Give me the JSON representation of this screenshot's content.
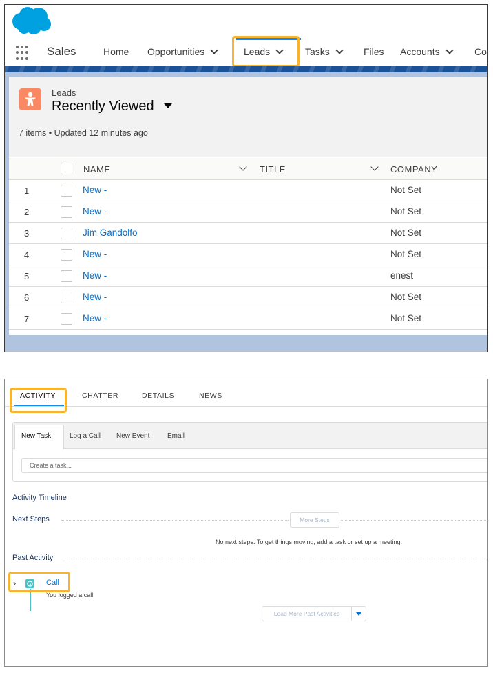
{
  "top_nav": {
    "app_name": "Sales",
    "items": [
      "Home",
      "Opportunities",
      "Leads",
      "Tasks",
      "Files",
      "Accounts",
      "Co"
    ]
  },
  "list_view": {
    "object_label": "Leads",
    "view_name": "Recently Viewed",
    "meta": "7 items • Updated 12 minutes ago",
    "columns": [
      "NAME",
      "TITLE",
      "COMPANY"
    ],
    "rows": [
      {
        "num": "1",
        "name": "New -",
        "company": "Not Set"
      },
      {
        "num": "2",
        "name": "New -",
        "company": "Not Set"
      },
      {
        "num": "3",
        "name": "Jim Gandolfo",
        "company": "Not Set"
      },
      {
        "num": "4",
        "name": "New -",
        "company": "Not Set"
      },
      {
        "num": "5",
        "name": "New -",
        "company": "enest"
      },
      {
        "num": "6",
        "name": "New -",
        "company": "Not Set"
      },
      {
        "num": "7",
        "name": "New -",
        "company": "Not Set"
      }
    ]
  },
  "record_tabs": [
    "ACTIVITY",
    "CHATTER",
    "DETAILS",
    "NEWS"
  ],
  "composer": {
    "tabs": [
      "New Task",
      "Log a Call",
      "New Event",
      "Email"
    ],
    "placeholder": "Create a task..."
  },
  "timeline": {
    "title": "Activity Timeline",
    "next_steps": "Next Steps",
    "more_steps": "More Steps",
    "no_steps_msg": "No next steps. To get things moving, add a task or set up a meeting.",
    "past_activity": "Past Activity",
    "call_label": "Call",
    "call_desc": "You logged a call",
    "load_more": "Load More Past Activities"
  },
  "colors": {
    "highlight": "#f7b431",
    "brand": "#00a1e0",
    "link": "#0070d2",
    "lead_icon": "#f88962",
    "call_icon": "#48c3cc"
  }
}
